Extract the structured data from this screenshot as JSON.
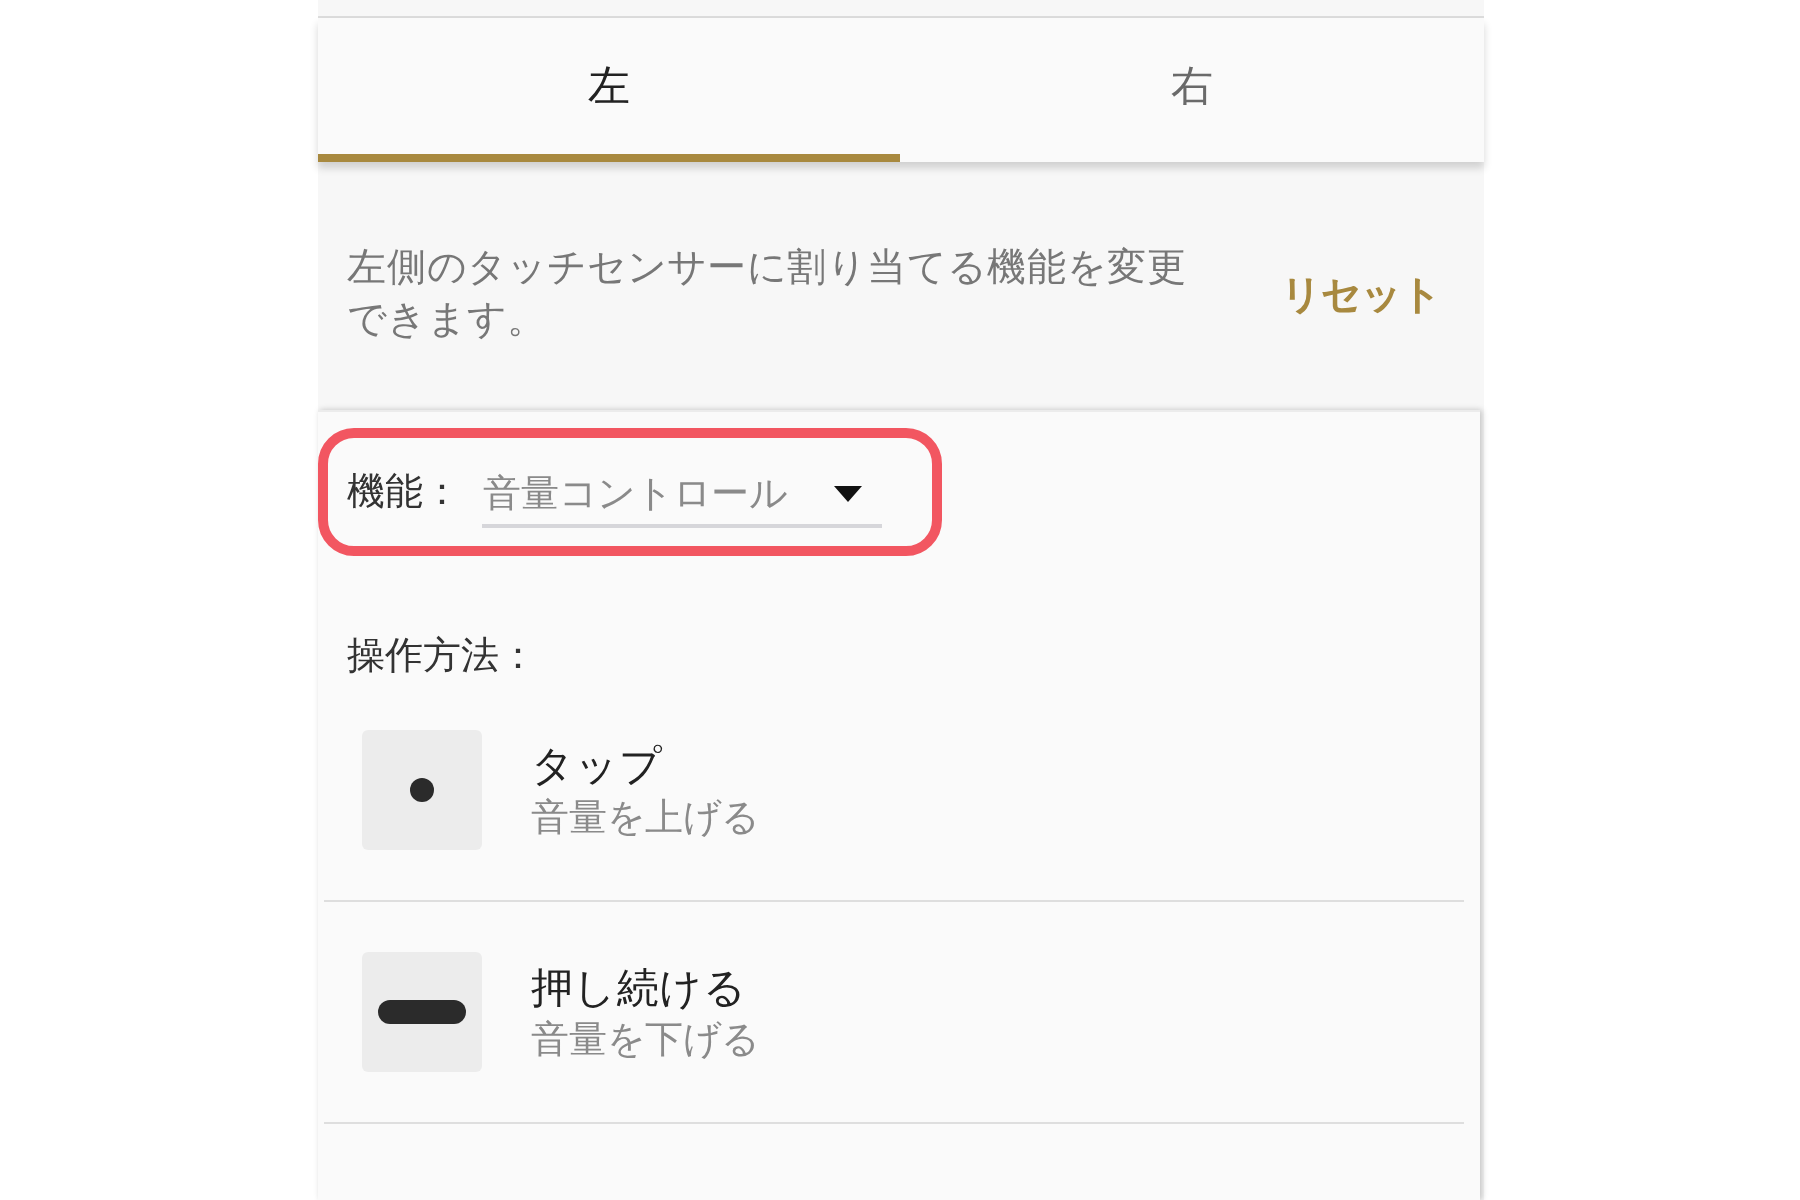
{
  "tabs": [
    {
      "label": "左",
      "selected": true
    },
    {
      "label": "右",
      "selected": false
    }
  ],
  "description": "左側のタッチセンサーに割り当てる機能を変更できます。",
  "reset_button": "リセット",
  "function": {
    "label": "機能：",
    "value": "音量コントロール"
  },
  "operation_label": "操作方法：",
  "operations": [
    {
      "kind": "tap",
      "title": "タップ",
      "subtitle": "音量を上げる"
    },
    {
      "kind": "hold",
      "title": "押し続ける",
      "subtitle": "音量を下げる"
    }
  ]
}
